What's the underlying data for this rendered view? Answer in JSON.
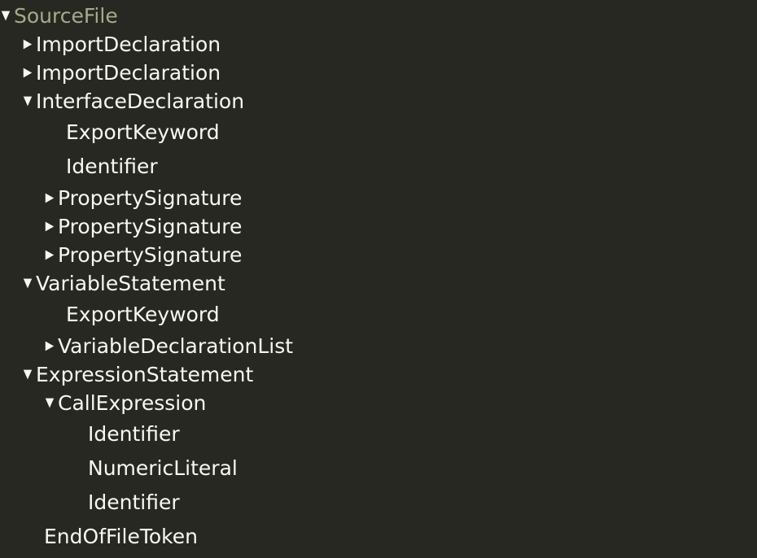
{
  "colors": {
    "background": "#272822",
    "text": "#f8f8f2",
    "root_text": "#a6aa8a"
  },
  "tree": [
    {
      "label": "SourceFile",
      "level": 0,
      "state": "expanded"
    },
    {
      "label": "ImportDeclaration",
      "level": 1,
      "state": "collapsed"
    },
    {
      "label": "ImportDeclaration",
      "level": 1,
      "state": "collapsed"
    },
    {
      "label": "InterfaceDeclaration",
      "level": 1,
      "state": "expanded"
    },
    {
      "label": "ExportKeyword",
      "level": 2,
      "state": "leaf"
    },
    {
      "label": "Identifier",
      "level": 2,
      "state": "leaf"
    },
    {
      "label": "PropertySignature",
      "level": 2,
      "state": "collapsed"
    },
    {
      "label": "PropertySignature",
      "level": 2,
      "state": "collapsed"
    },
    {
      "label": "PropertySignature",
      "level": 2,
      "state": "collapsed"
    },
    {
      "label": "VariableStatement",
      "level": 1,
      "state": "expanded"
    },
    {
      "label": "ExportKeyword",
      "level": 2,
      "state": "leaf"
    },
    {
      "label": "VariableDeclarationList",
      "level": 2,
      "state": "collapsed"
    },
    {
      "label": "ExpressionStatement",
      "level": 1,
      "state": "expanded"
    },
    {
      "label": "CallExpression",
      "level": 2,
      "state": "expanded"
    },
    {
      "label": "Identifier",
      "level": 3,
      "state": "leaf"
    },
    {
      "label": "NumericLiteral",
      "level": 3,
      "state": "leaf"
    },
    {
      "label": "Identifier",
      "level": 3,
      "state": "leaf"
    },
    {
      "label": "EndOfFileToken",
      "level": 1,
      "state": "leaf"
    }
  ],
  "icons": {
    "expanded": "▼",
    "collapsed": "▶"
  }
}
